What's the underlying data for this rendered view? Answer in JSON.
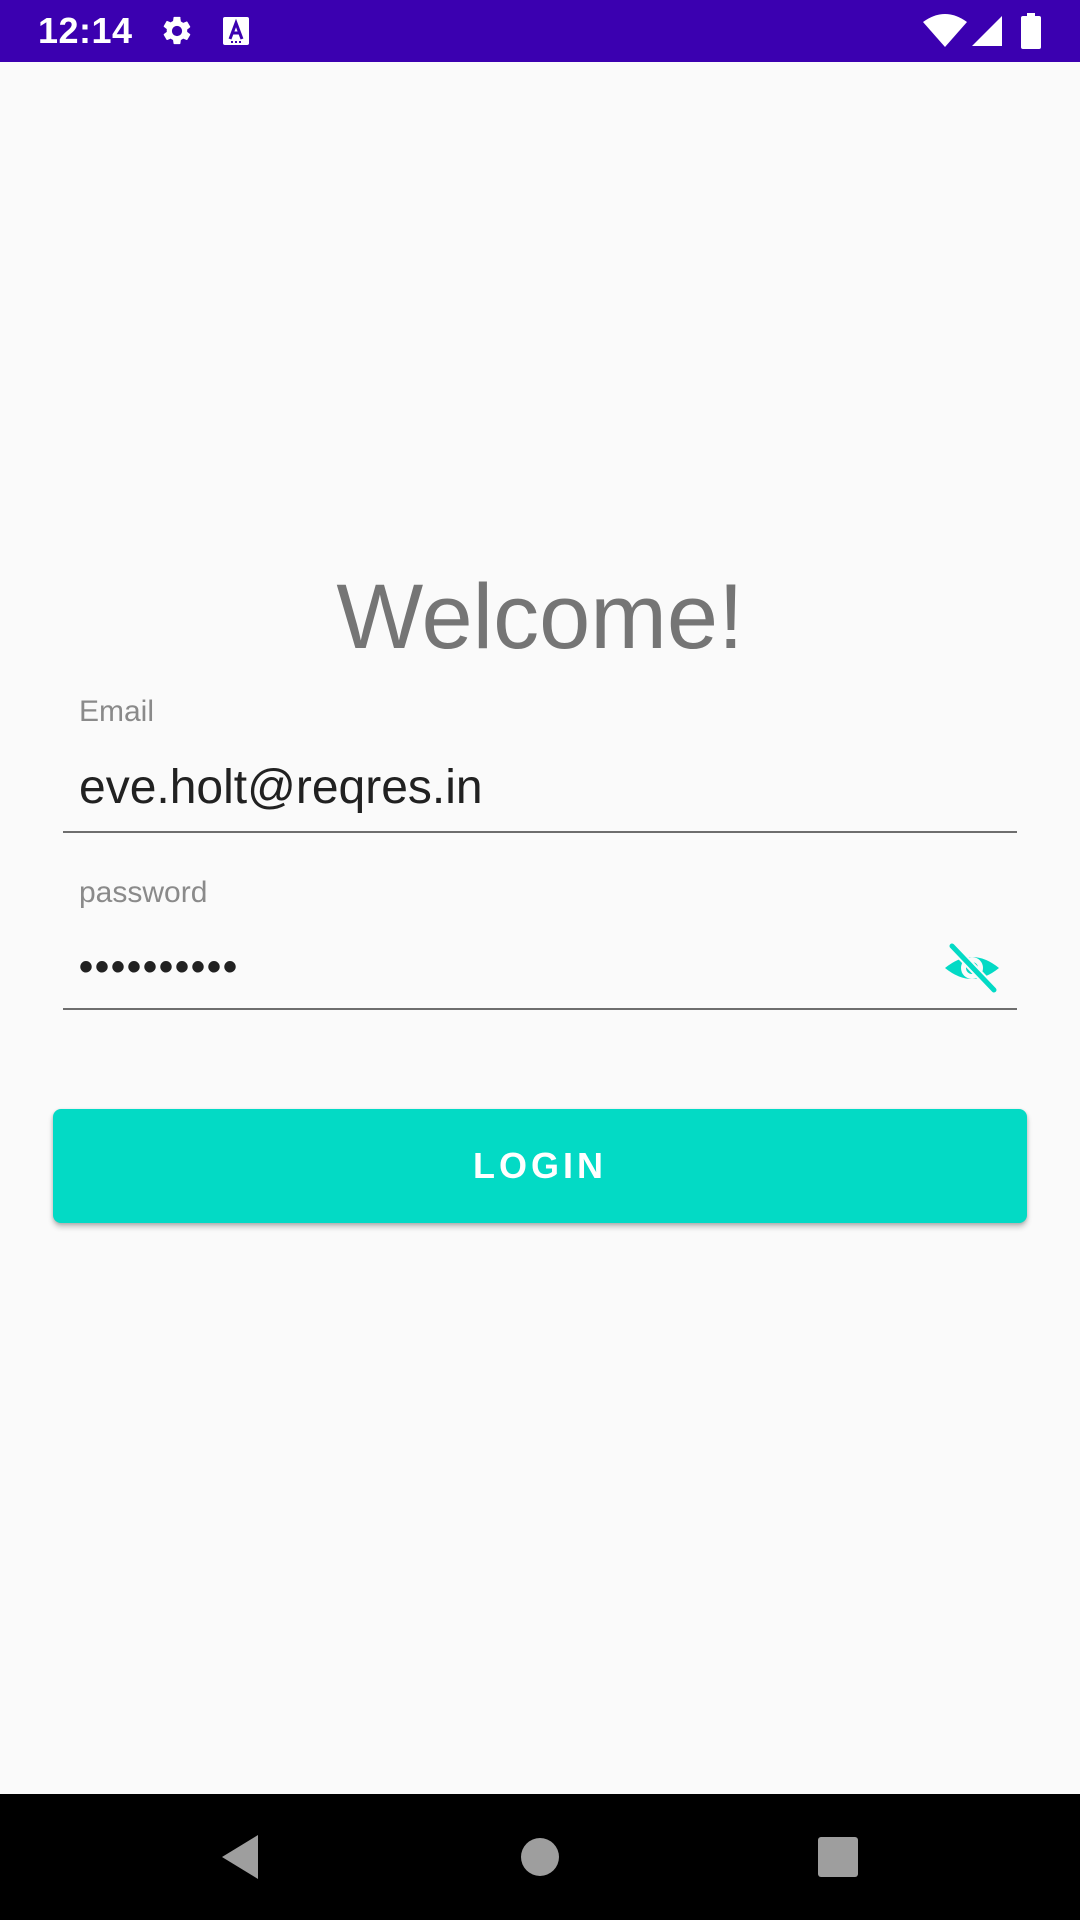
{
  "status_bar": {
    "time": "12:14",
    "background_color": "#3b00b0",
    "icons": [
      "gear-icon",
      "a-text-icon",
      "wifi-icon",
      "signal-icon",
      "battery-icon"
    ]
  },
  "login": {
    "title": "Welcome!",
    "email": {
      "label": "Email",
      "value": "eve.holt@reqres.in"
    },
    "password": {
      "label": "password",
      "value_masked": "••••••••••",
      "visibility_icon": "visibility-off-icon"
    },
    "button_label": "LOGIN",
    "accent_color": "#03dac5"
  },
  "nav_bar": {
    "buttons": [
      "back-icon",
      "home-icon",
      "recents-icon"
    ]
  }
}
